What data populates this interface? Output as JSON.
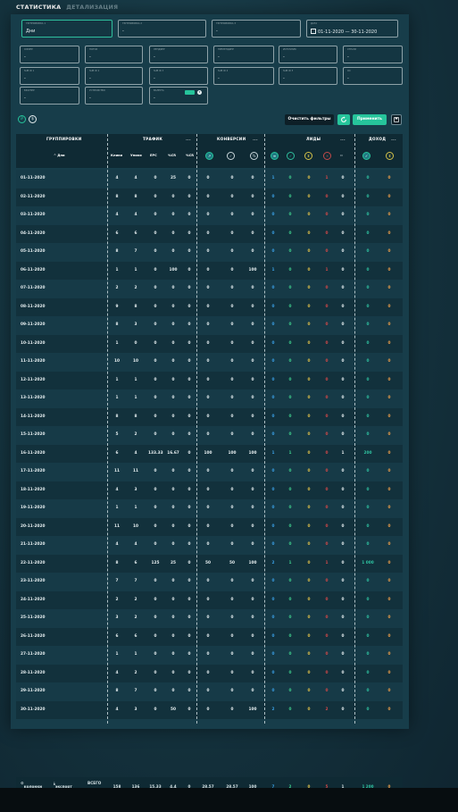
{
  "tabs": [
    "СТАТИСТИКА",
    "ДЕТАЛИЗАЦИЯ"
  ],
  "filters_top": [
    {
      "label": "ГРУППИРОВКА 1",
      "value": "Дни"
    },
    {
      "label": "ГРУППИРОВКА 2",
      "value": "-"
    },
    {
      "label": "ГРУППИРОВКА 3",
      "value": "-"
    },
    {
      "label": "ДАТА",
      "value": "01-11-2020 — 30-11-2020"
    }
  ],
  "filters_row2": [
    {
      "label": "ОФФЕР",
      "value": "-"
    },
    {
      "label": "ПОТОК",
      "value": "-"
    },
    {
      "label": "ЛЕНДИНГ",
      "value": "-"
    },
    {
      "label": "ПРЕЛЕНДИНГ",
      "value": "-"
    },
    {
      "label": "ИСТОЧНИК",
      "value": "-"
    },
    {
      "label": "СТРАНА",
      "value": "-"
    }
  ],
  "filters_row3": [
    {
      "label": "SUB ID 1",
      "value": "-"
    },
    {
      "label": "SUB ID 2",
      "value": "-"
    },
    {
      "label": "SUB ID 3",
      "value": "-"
    },
    {
      "label": "SUB ID 4",
      "value": "-"
    },
    {
      "label": "SUB ID 5",
      "value": "-"
    },
    {
      "label": "ОС",
      "value": "-"
    }
  ],
  "filters_row4": [
    {
      "label": "БРАУЗЕР",
      "value": "-"
    },
    {
      "label": "УСТРОЙСТВО",
      "value": "-"
    },
    {
      "label": "ВАЛЮТА",
      "value": "-"
    }
  ],
  "toolbar": {
    "circle1": "₽",
    "circle2": "$",
    "clear": "Очистить фильтры",
    "apply": "Применить"
  },
  "header": {
    "groups": [
      "ГРУППИРОВКИ",
      "ТРАФИК",
      "КОНВЕРСИИ",
      "ЛИДЫ",
      "ДОХОД"
    ],
    "day_col": "^ Дни",
    "traffic_cols": [
      "Клики",
      "Уники",
      "EPC",
      "%CR",
      "%CR"
    ]
  },
  "rows": [
    [
      "01-11-2020",
      "4",
      "4",
      "0",
      "25",
      "0",
      "0",
      "0",
      "0",
      "1",
      "0",
      "0",
      "1",
      "0",
      "0",
      "0"
    ],
    [
      "02-11-2020",
      "8",
      "8",
      "0",
      "0",
      "0",
      "0",
      "0",
      "0",
      "0",
      "0",
      "0",
      "0",
      "0",
      "0",
      "0"
    ],
    [
      "03-11-2020",
      "4",
      "4",
      "0",
      "0",
      "0",
      "0",
      "0",
      "0",
      "0",
      "0",
      "0",
      "0",
      "0",
      "0",
      "0"
    ],
    [
      "04-11-2020",
      "6",
      "6",
      "0",
      "0",
      "0",
      "0",
      "0",
      "0",
      "0",
      "0",
      "0",
      "0",
      "0",
      "0",
      "0"
    ],
    [
      "05-11-2020",
      "8",
      "7",
      "0",
      "0",
      "0",
      "0",
      "0",
      "0",
      "0",
      "0",
      "0",
      "0",
      "0",
      "0",
      "0"
    ],
    [
      "06-11-2020",
      "1",
      "1",
      "0",
      "100",
      "0",
      "0",
      "0",
      "100",
      "1",
      "0",
      "0",
      "1",
      "0",
      "0",
      "0"
    ],
    [
      "07-11-2020",
      "2",
      "2",
      "0",
      "0",
      "0",
      "0",
      "0",
      "0",
      "0",
      "0",
      "0",
      "0",
      "0",
      "0",
      "0"
    ],
    [
      "08-11-2020",
      "9",
      "8",
      "0",
      "0",
      "0",
      "0",
      "0",
      "0",
      "0",
      "0",
      "0",
      "0",
      "0",
      "0",
      "0"
    ],
    [
      "09-11-2020",
      "8",
      "3",
      "0",
      "0",
      "0",
      "0",
      "0",
      "0",
      "0",
      "0",
      "0",
      "0",
      "0",
      "0",
      "0"
    ],
    [
      "10-11-2020",
      "1",
      "0",
      "0",
      "0",
      "0",
      "0",
      "0",
      "0",
      "0",
      "0",
      "0",
      "0",
      "0",
      "0",
      "0"
    ],
    [
      "11-11-2020",
      "10",
      "10",
      "0",
      "0",
      "0",
      "0",
      "0",
      "0",
      "0",
      "0",
      "0",
      "0",
      "0",
      "0",
      "0"
    ],
    [
      "12-11-2020",
      "1",
      "1",
      "0",
      "0",
      "0",
      "0",
      "0",
      "0",
      "0",
      "0",
      "0",
      "0",
      "0",
      "0",
      "0"
    ],
    [
      "13-11-2020",
      "1",
      "1",
      "0",
      "0",
      "0",
      "0",
      "0",
      "0",
      "0",
      "0",
      "0",
      "0",
      "0",
      "0",
      "0"
    ],
    [
      "14-11-2020",
      "8",
      "8",
      "0",
      "0",
      "0",
      "0",
      "0",
      "0",
      "0",
      "0",
      "0",
      "0",
      "0",
      "0",
      "0"
    ],
    [
      "15-11-2020",
      "5",
      "2",
      "0",
      "0",
      "0",
      "0",
      "0",
      "0",
      "0",
      "0",
      "0",
      "0",
      "0",
      "0",
      "0"
    ],
    [
      "16-11-2020",
      "6",
      "4",
      "133.33",
      "16.67",
      "0",
      "100",
      "100",
      "100",
      "1",
      "1",
      "0",
      "0",
      "1",
      "200",
      "0"
    ],
    [
      "17-11-2020",
      "11",
      "11",
      "0",
      "0",
      "0",
      "0",
      "0",
      "0",
      "0",
      "0",
      "0",
      "0",
      "0",
      "0",
      "0"
    ],
    [
      "18-11-2020",
      "4",
      "3",
      "0",
      "0",
      "0",
      "0",
      "0",
      "0",
      "0",
      "0",
      "0",
      "0",
      "0",
      "0",
      "0"
    ],
    [
      "19-11-2020",
      "1",
      "1",
      "0",
      "0",
      "0",
      "0",
      "0",
      "0",
      "0",
      "0",
      "0",
      "0",
      "0",
      "0",
      "0"
    ],
    [
      "20-11-2020",
      "11",
      "10",
      "0",
      "0",
      "0",
      "0",
      "0",
      "0",
      "0",
      "0",
      "0",
      "0",
      "0",
      "0",
      "0"
    ],
    [
      "21-11-2020",
      "4",
      "4",
      "0",
      "0",
      "0",
      "0",
      "0",
      "0",
      "0",
      "0",
      "0",
      "0",
      "0",
      "0",
      "0"
    ],
    [
      "22-11-2020",
      "8",
      "6",
      "125",
      "25",
      "0",
      "50",
      "50",
      "100",
      "2",
      "1",
      "0",
      "1",
      "0",
      "1 000",
      "0"
    ],
    [
      "23-11-2020",
      "7",
      "7",
      "0",
      "0",
      "0",
      "0",
      "0",
      "0",
      "0",
      "0",
      "0",
      "0",
      "0",
      "0",
      "0"
    ],
    [
      "24-11-2020",
      "2",
      "2",
      "0",
      "0",
      "0",
      "0",
      "0",
      "0",
      "0",
      "0",
      "0",
      "0",
      "0",
      "0",
      "0"
    ],
    [
      "25-11-2020",
      "3",
      "2",
      "0",
      "0",
      "0",
      "0",
      "0",
      "0",
      "0",
      "0",
      "0",
      "0",
      "0",
      "0",
      "0"
    ],
    [
      "26-11-2020",
      "6",
      "6",
      "0",
      "0",
      "0",
      "0",
      "0",
      "0",
      "0",
      "0",
      "0",
      "0",
      "0",
      "0",
      "0"
    ],
    [
      "27-11-2020",
      "1",
      "1",
      "0",
      "0",
      "0",
      "0",
      "0",
      "0",
      "0",
      "0",
      "0",
      "0",
      "0",
      "0",
      "0"
    ],
    [
      "28-11-2020",
      "4",
      "2",
      "0",
      "0",
      "0",
      "0",
      "0",
      "0",
      "0",
      "0",
      "0",
      "0",
      "0",
      "0",
      "0"
    ],
    [
      "29-11-2020",
      "8",
      "7",
      "0",
      "0",
      "0",
      "0",
      "0",
      "0",
      "0",
      "0",
      "0",
      "0",
      "0",
      "0",
      "0"
    ],
    [
      "30-11-2020",
      "4",
      "3",
      "0",
      "50",
      "0",
      "0",
      "0",
      "100",
      "2",
      "0",
      "0",
      "2",
      "0",
      "0",
      "0"
    ]
  ],
  "footer": {
    "columns_btn": "колонки",
    "export_btn": "экспорт",
    "total_label": "ВСЕГО",
    "values": [
      "158",
      "136",
      "15.33",
      "4.4",
      "0",
      "28.57",
      "28.57",
      "100",
      "7",
      "2",
      "0",
      "5",
      "1",
      "1 200",
      "0"
    ]
  }
}
